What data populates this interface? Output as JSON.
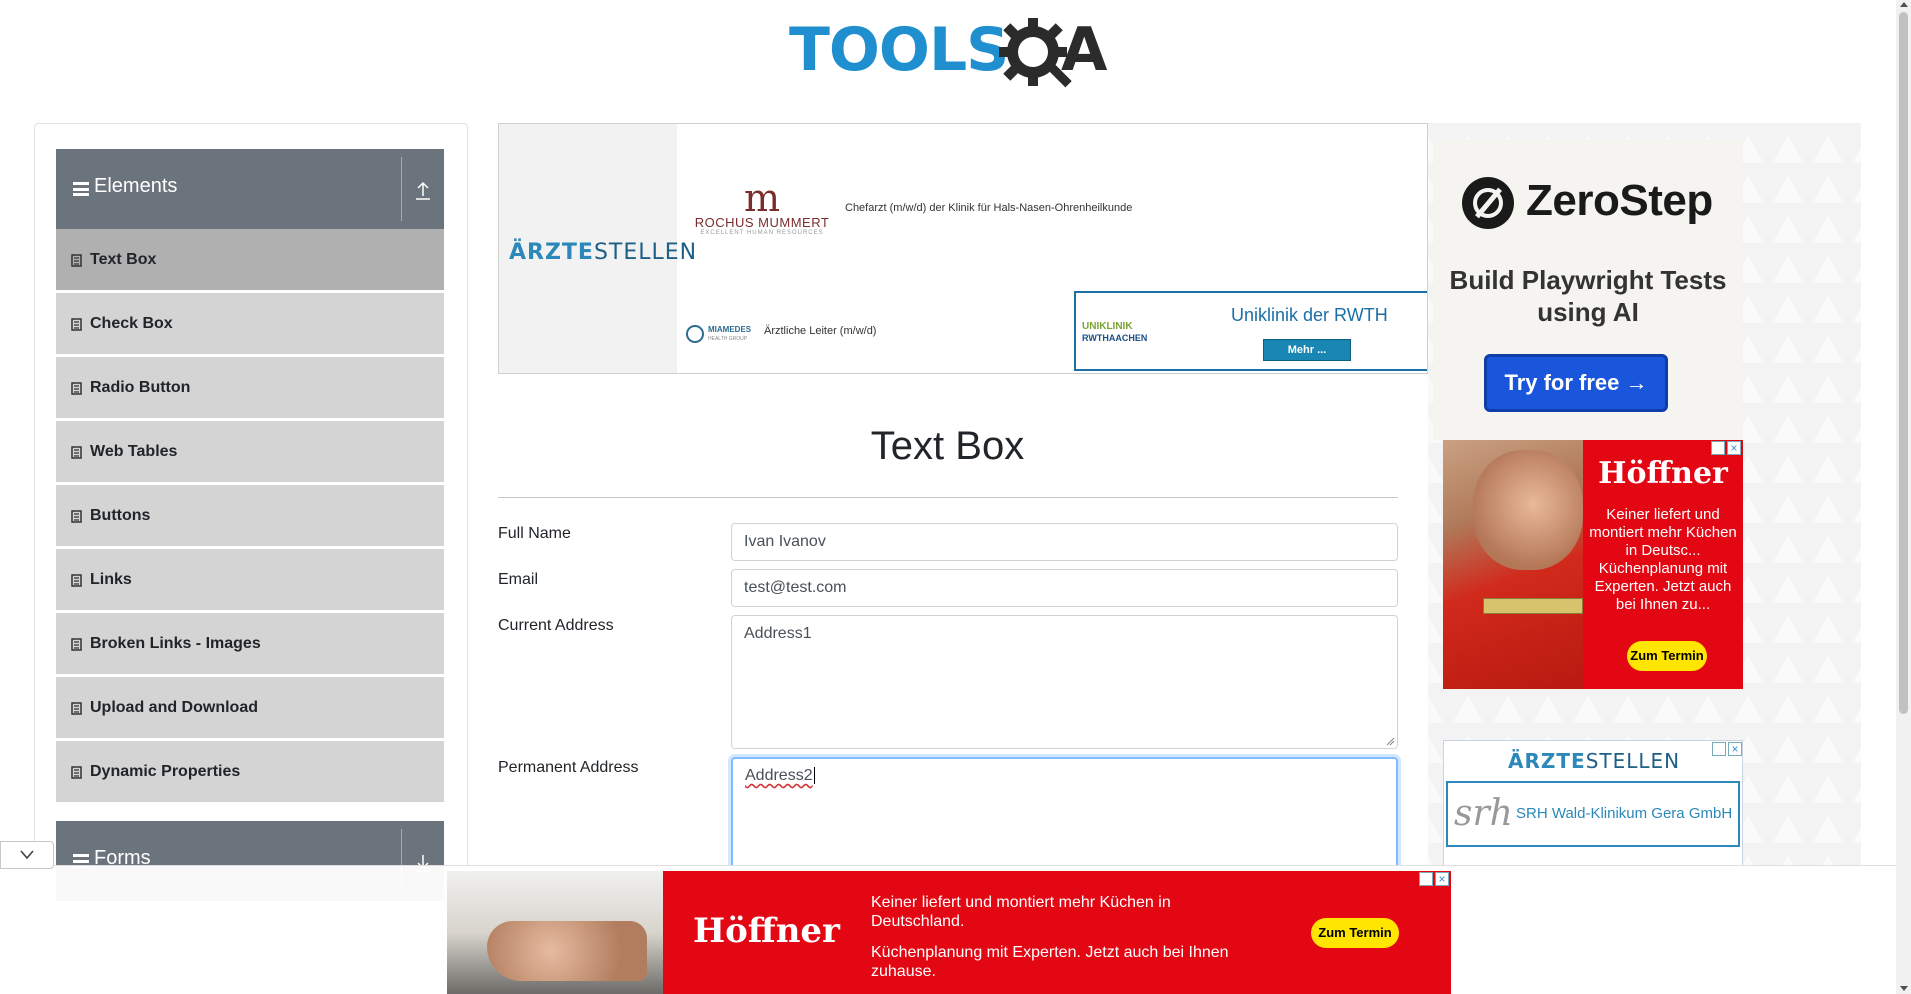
{
  "header": {
    "logo_text": "TOOLS",
    "logo_suffix": "A",
    "logo_icon": "gear-magnifier-icon"
  },
  "sidebar": {
    "groups": [
      {
        "label": "Elements",
        "icon": "menu-icon",
        "toggle_icon": "collapse-up-icon"
      },
      {
        "label": "Forms",
        "icon": "menu-icon",
        "toggle_icon": "expand-down-icon"
      }
    ],
    "items": [
      {
        "label": "Text Box",
        "active": true
      },
      {
        "label": "Check Box"
      },
      {
        "label": "Radio Button"
      },
      {
        "label": "Web Tables"
      },
      {
        "label": "Buttons"
      },
      {
        "label": "Links"
      },
      {
        "label": "Broken Links - Images"
      },
      {
        "label": "Upload and Download"
      },
      {
        "label": "Dynamic Properties"
      }
    ]
  },
  "ad_top": {
    "brand_bold": "ÄRZTE",
    "brand_light": "STELLEN",
    "rm_name": "ROCHUS MUMMERT",
    "rm_sub": "EXCELLENT HUMAN RESOURCES",
    "job1": "Chefarzt (m/w/d) der Klinik für Hals-Nasen-Ohrenheilkunde",
    "miamedes": "MIAMEDES",
    "miamedes_sub": "HEALTH GROUP",
    "job2": "Ärztliche Leiter (m/w/d)",
    "uniklinik_line1": "UNIKLINIK",
    "uniklinik_line2": "RWTHAACHEN",
    "uniklinik_title": "Uniklinik der RWTH",
    "mehr": "Mehr ..."
  },
  "main": {
    "title": "Text Box",
    "fields": {
      "full_name_label": "Full Name",
      "full_name_value": "Ivan Ivanov",
      "email_label": "Email",
      "email_value": "test@test.com",
      "current_address_label": "Current Address",
      "current_address_value": "Address1",
      "permanent_address_label": "Permanent Address",
      "permanent_address_value": "Address2"
    }
  },
  "right_ads": {
    "zerostep_name": "ZeroStep",
    "zerostep_tag": "Build Playwright Tests using AI",
    "zerostep_cta": "Try for free →",
    "hoffner_brand": "Höffner",
    "hoffner_text": "Keiner liefert und montiert mehr Küchen in Deutsc... Küchenplanung mit Experten. Jetzt auch bei Ihnen zu...",
    "hoffner_cta": "Zum Termin",
    "aerzte_brand_bold": "ÄRZTE",
    "aerzte_brand_light": "STELLEN",
    "srh_logo": "srh",
    "srh_name": "SRH Wald-Klinikum Gera GmbH"
  },
  "bottom_ad": {
    "brand": "Höffner",
    "line1": "Keiner liefert und montiert mehr Küchen in Deutschland.",
    "line2": "Küchenplanung mit Experten. Jetzt auch bei Ihnen zuhause.",
    "cta": "Zum Termin"
  },
  "colors": {
    "accent": "#1f8fcf",
    "sidebar_header": "#6b737d",
    "sidebar_item": "#d4d4d4",
    "sidebar_item_active": "#b0b0b0",
    "hoffner_red": "#e30613",
    "cta_yellow": "#ffe500",
    "zerostep_blue": "#1a56db"
  }
}
